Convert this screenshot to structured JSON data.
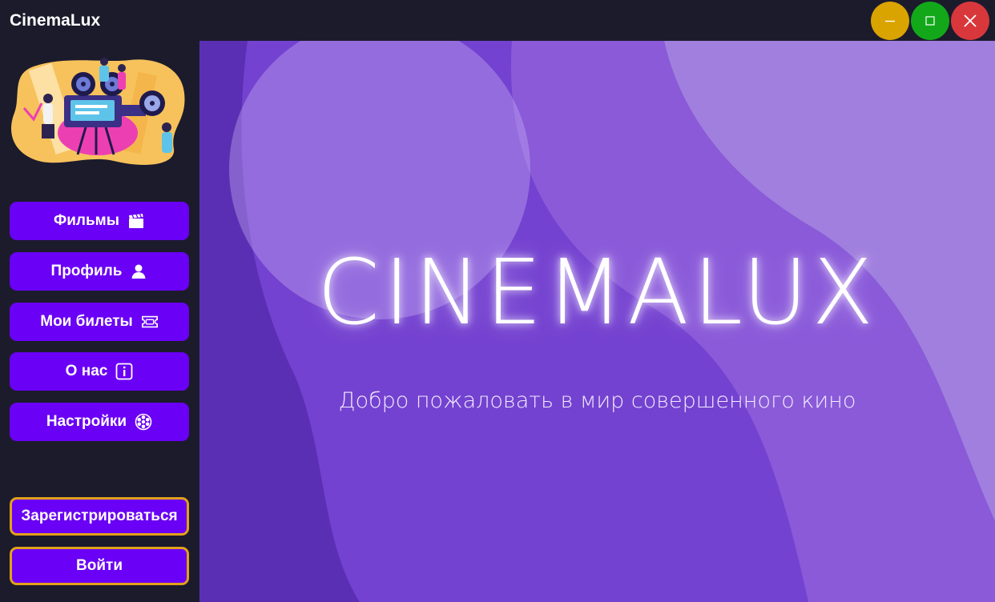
{
  "window": {
    "title": "CinemaLux",
    "controls": {
      "minimize_color": "#d9a300",
      "maximize_color": "#13a81a",
      "close_color": "#d8383c"
    }
  },
  "sidebar": {
    "illustration": "cinema-crew-projector-illustration",
    "nav": [
      {
        "label": "Фильмы",
        "icon": "clapperboard-icon"
      },
      {
        "label": "Профиль",
        "icon": "user-icon"
      },
      {
        "label": "Мои билеты",
        "icon": "ticket-icon"
      },
      {
        "label": "О нас",
        "icon": "info-icon"
      },
      {
        "label": "Настройки",
        "icon": "settings-icon"
      }
    ],
    "auth": {
      "register_label": "Зарегистрироваться",
      "login_label": "Войти"
    }
  },
  "hero": {
    "brand": "CINEMALUX",
    "tagline": "Добро пожаловать в мир совершенного кино"
  },
  "colors": {
    "sidebar_bg": "#1c1b2c",
    "button": "#6a00f5",
    "button_outline": "#e2a11a",
    "hero_purple": "#7b45d6"
  }
}
